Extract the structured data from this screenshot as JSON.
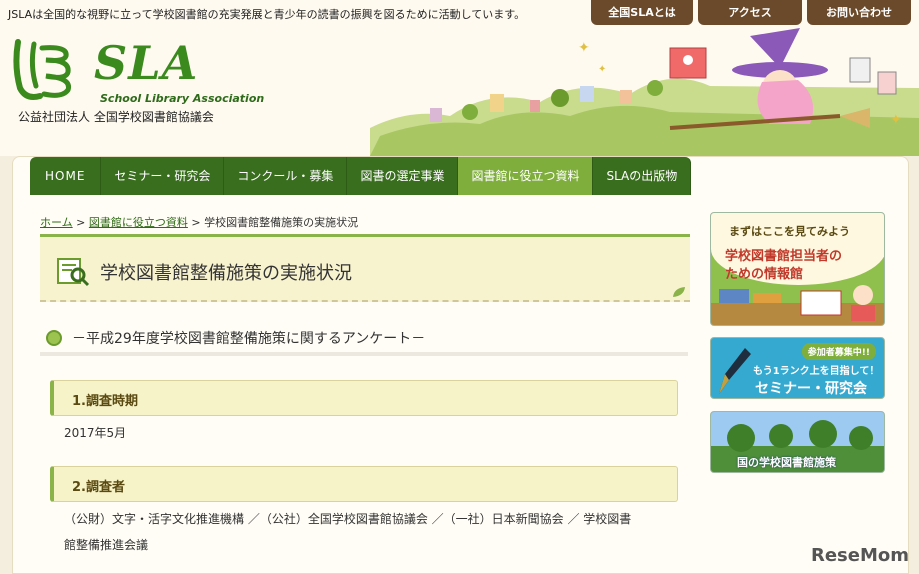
{
  "header": {
    "tagline": "JSLAは全国的な視野に立って学校図書館の充実発展と青少年の読書の振興を図るために活動しています。",
    "toplinks": [
      "全国SLAとは",
      "アクセス",
      "お問い合わせ"
    ],
    "logo_text": "SLA",
    "logo_english": "School Library Association",
    "logo_japanese": "公益社団法人 全国学校図書館協議会"
  },
  "nav": {
    "items": [
      "HOME",
      "セミナー・研究会",
      "コンクール・募集",
      "図書の選定事業",
      "図書館に役立つ資料",
      "SLAの出版物"
    ],
    "active_index": 4
  },
  "breadcrumb": {
    "home": "ホーム",
    "sep": ">",
    "parent": "図書館に役立つ資料",
    "current": "学校図書館整備施策の実施状況"
  },
  "main": {
    "page_title": "学校図書館整備施策の実施状況",
    "subtitle": "－平成29年度学校図書館整備施策に関するアンケート－",
    "sections": [
      {
        "heading": "1.調査時期",
        "body": "2017年5月"
      },
      {
        "heading": "2.調査者",
        "body_line1": "（公財）文字・活字文化推進機構 ／（公社）全国学校図書館協議会 ／（一社）日本新聞協会 ／ 学校図書",
        "body_line2": "館整備推進会議"
      }
    ]
  },
  "sidebar": {
    "banner1": {
      "line1": "まずはここを見てみよう",
      "line2": "学校図書館担当者の",
      "line3": "ための情報館"
    },
    "banner2": {
      "badge": "参加者募集中!!",
      "line1": "もう1ランク上を目指して！",
      "line2": "セミナー・研究会"
    },
    "banner3": {
      "label": "国の学校図書館施策"
    }
  },
  "watermark": "ReseMom",
  "colors": {
    "nav_green": "#3a6e1f",
    "nav_active": "#7fae3d",
    "brand_green": "#3b8a1e",
    "toplink_brown": "#6a4a2b"
  }
}
